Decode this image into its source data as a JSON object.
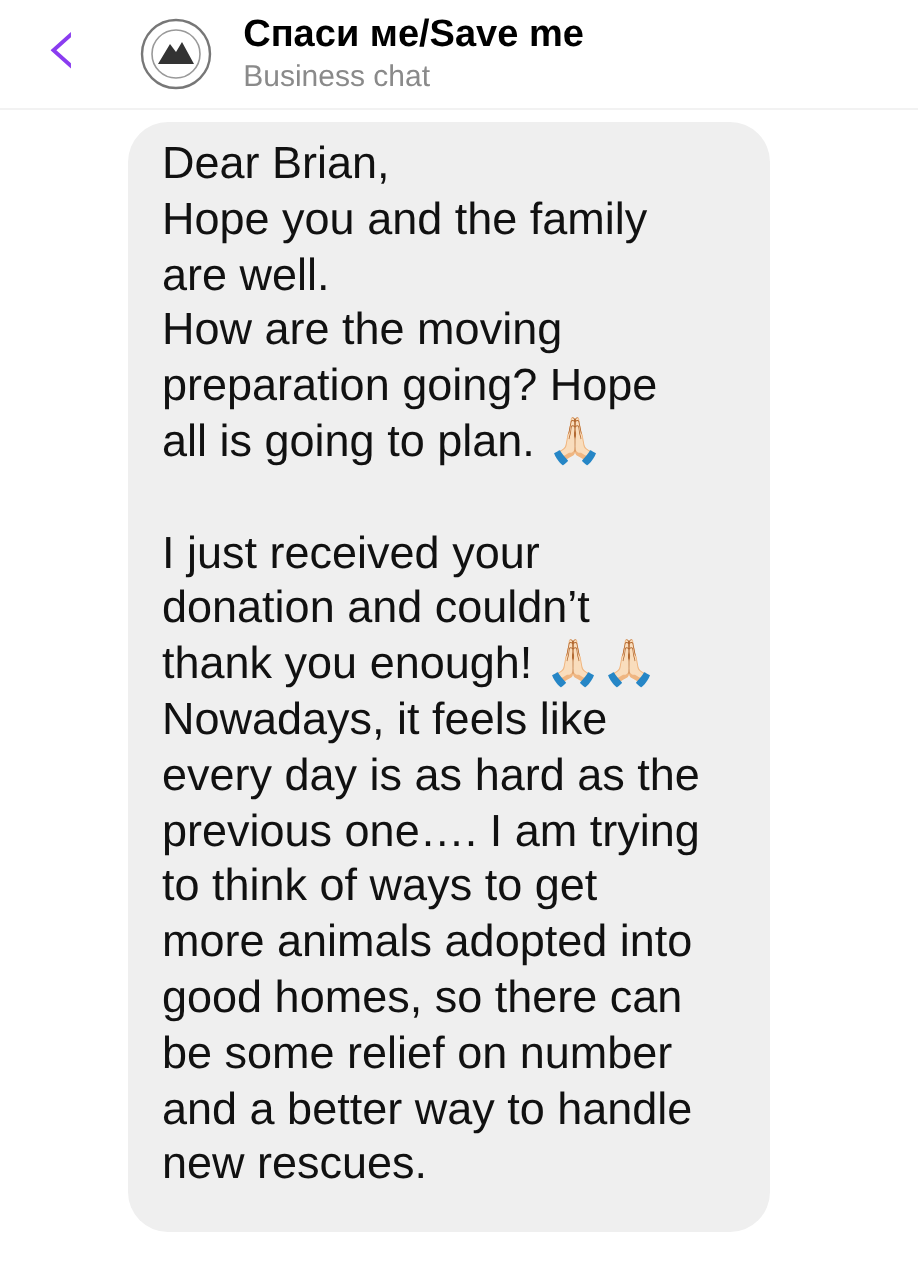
{
  "header": {
    "back": "‹",
    "title": "Спаси ме/Save me",
    "subtitle": "Business chat"
  },
  "messages": [
    {
      "kind": "incoming",
      "text": "Dear Brian,\nHope you and the family\nare well.\nHow are the moving\npreparation going? Hope\nall is going to plan. 🙏🏻\n\nI just received your\ndonation and couldn’t\nthank you enough! 🙏🏻🙏🏻\nNowadays, it feels like\nevery day is as hard as the\nprevious one…. I am trying\nto think of ways to get\nmore animals adopted into\ngood homes, so there can\nbe some relief on number\nand a better way to handle\nnew rescues."
    }
  ]
}
